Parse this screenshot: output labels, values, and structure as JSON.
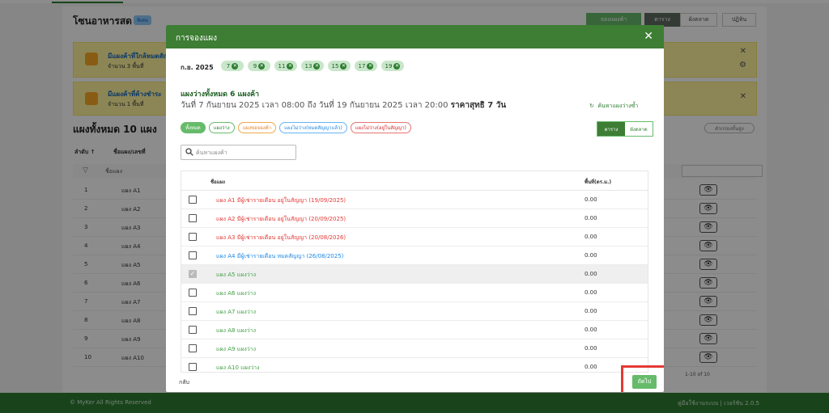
{
  "background": {
    "page_title": "โซนอาหารสด",
    "badge": "พิเศษ",
    "top_buttons": [
      "จองแผงค้า",
      "ตาราง",
      "ผังตลาด",
      "ปฏิทิน"
    ],
    "alerts": [
      {
        "title": "มีแผงค้าที่ใกล้หมดสัญญา",
        "detail": "จำนวน 3 พื้นที่"
      },
      {
        "title": "มีแผงค้าที่ค้างชำระ",
        "detail": "จำนวน 1 พื้นที่"
      }
    ],
    "section_title": "แผงทั้งหมด 10 แผง",
    "filter_pill": "ตัวกรองขั้นสูง",
    "columns": [
      "ลำดับ ↑",
      "ชื่อแผง/เลขที่"
    ],
    "filter_placeholder": "ชื่อแผง",
    "rows": [
      {
        "no": "1",
        "name": "แผง A1"
      },
      {
        "no": "2",
        "name": "แผง A2"
      },
      {
        "no": "3",
        "name": "แผง A3"
      },
      {
        "no": "4",
        "name": "แผง A4"
      },
      {
        "no": "5",
        "name": "แผง A5"
      },
      {
        "no": "6",
        "name": "แผง A6"
      },
      {
        "no": "7",
        "name": "แผง A7"
      },
      {
        "no": "8",
        "name": "แผง A8"
      },
      {
        "no": "9",
        "name": "แผง A9"
      },
      {
        "no": "10",
        "name": "แผง A10"
      }
    ],
    "pager": "1-10 of 10",
    "footer_left": "© MyKer All Rights Reserved",
    "footer_right": "คู่มือใช้งานระบบ | เวอร์ชัน 2.0.5"
  },
  "modal": {
    "title": "การจองแผง",
    "close_icon": "close-icon",
    "month_label": "ก.ย. 2025",
    "date_chips": [
      "7",
      "9",
      "11",
      "13",
      "15",
      "17",
      "19"
    ],
    "summary_title": "แผงว่างทั้งหมด 6 แผงค้า",
    "summary_range": "วันที่ 7 กันยายน 2025 เวลา 08:00 ถึง วันที่ 19 กันยายน 2025 เวลา 20:00",
    "summary_price": "ราคาสุทธิ 7 วัน",
    "refresh_label": "ค้นหาแผงว่างซ้ำ",
    "filter_chips": {
      "all": "ทั้งหมด",
      "empty": "แผงว่าง",
      "requested": "แผงขอจองค้า",
      "unavailable_paid": "แผงไม่ว่าง(หมดสัญญาแล้ว)",
      "unavailable_contract": "แผงไม่ว่าง(อยู่ในสัญญา)"
    },
    "view_toggle": {
      "table": "ตาราง",
      "map": "ผังตลาด"
    },
    "search_placeholder": "ค้นหาแผงค้า",
    "table": {
      "col_name": "ชื่อแผง",
      "col_area": "พื้นที่(ตร.ม.)",
      "rows": [
        {
          "name": "แผง A1 มีผู้เช่ารายเดือน อยู่ในสัญญา (19/09/2025)",
          "area": "0.00",
          "status": "red",
          "checked": false
        },
        {
          "name": "แผง A2 มีผู้เช่ารายเดือน อยู่ในสัญญา (20/09/2025)",
          "area": "0.00",
          "status": "red",
          "checked": false
        },
        {
          "name": "แผง A3 มีผู้เช่ารายเดือน อยู่ในสัญญา (20/08/2026)",
          "area": "0.00",
          "status": "red",
          "checked": false
        },
        {
          "name": "แผง A4 มีผู้เช่ารายเดือน หมดสัญญา (26/08/2025)",
          "area": "0.00",
          "status": "blue",
          "checked": false
        },
        {
          "name": "แผง A5 แผงว่าง",
          "area": "0.00",
          "status": "green",
          "checked": true
        },
        {
          "name": "แผง A6 แผงว่าง",
          "area": "0.00",
          "status": "green",
          "checked": false
        },
        {
          "name": "แผง A7 แผงว่าง",
          "area": "0.00",
          "status": "green",
          "checked": false
        },
        {
          "name": "แผง A8 แผงว่าง",
          "area": "0.00",
          "status": "green",
          "checked": false
        },
        {
          "name": "แผง A9 แผงว่าง",
          "area": "0.00",
          "status": "green",
          "checked": false
        },
        {
          "name": "แผง A10 แผงว่าง",
          "area": "0.00",
          "status": "green",
          "checked": false
        }
      ]
    },
    "back_label": "กลับ",
    "next_label": "ถัดไป"
  },
  "colors": {
    "brand_green": "#3d7d34",
    "footer_green": "#2e7d32",
    "highlight_red": "#e53935"
  }
}
